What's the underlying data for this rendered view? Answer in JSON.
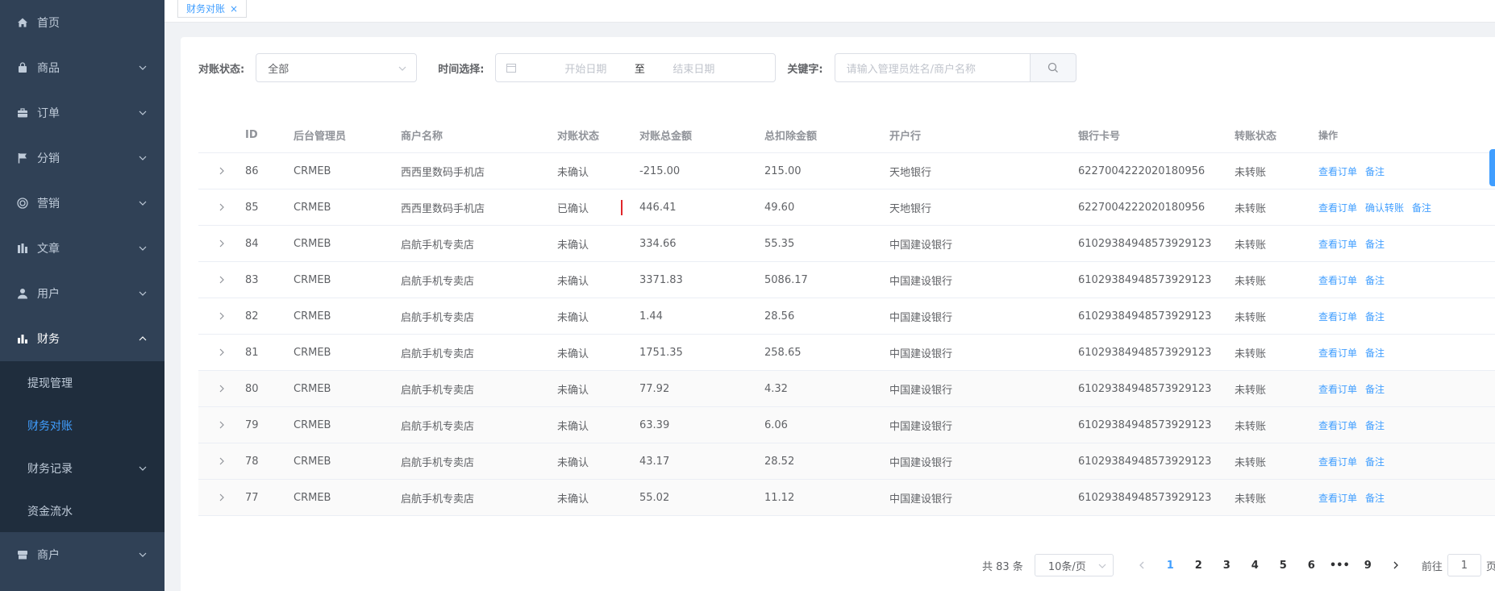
{
  "sidebar": {
    "items": [
      {
        "label": "首页",
        "icon": "home-icon",
        "chevron": false
      },
      {
        "label": "商品",
        "icon": "bag-icon",
        "chevron": true
      },
      {
        "label": "订单",
        "icon": "briefcase-icon",
        "chevron": true
      },
      {
        "label": "分销",
        "icon": "flag-icon",
        "chevron": true
      },
      {
        "label": "营销",
        "icon": "target-icon",
        "chevron": true
      },
      {
        "label": "文章",
        "icon": "chart-bars-icon",
        "chevron": true
      },
      {
        "label": "用户",
        "icon": "user-icon",
        "chevron": true
      },
      {
        "label": "财务",
        "icon": "bar-chart-icon",
        "chevron": true,
        "open": true
      }
    ],
    "finance_sub": [
      {
        "label": "提现管理"
      },
      {
        "label": "财务对账",
        "active": true
      },
      {
        "label": "财务记录",
        "chevron": true
      },
      {
        "label": "资金流水"
      }
    ],
    "after": [
      {
        "label": "商户",
        "icon": "shop-icon",
        "chevron": true
      }
    ]
  },
  "tab": {
    "label": "财务对账",
    "close": "×"
  },
  "filters": {
    "status_label": "对账状态:",
    "status_value": "全部",
    "time_label": "时间选择:",
    "start_placeholder": "开始日期",
    "separator": "至",
    "end_placeholder": "结束日期",
    "keyword_label": "关键字:",
    "keyword_placeholder": "请输入管理员姓名/商户名称"
  },
  "table": {
    "headers": [
      "ID",
      "后台管理员",
      "商户名称",
      "对账状态",
      "对账总金额",
      "总扣除金额",
      "开户行",
      "银行卡号",
      "转账状态",
      "操作"
    ],
    "rows": [
      {
        "id": "86",
        "admin": "CRMEB",
        "shop": "西西里数码手机店",
        "status": "未确认",
        "total": "-215.00",
        "deduct": "215.00",
        "bank": "天地银行",
        "card": "6227004222020180956",
        "transfer": "未转账",
        "ops": [
          "查看订单",
          "备注"
        ]
      },
      {
        "id": "85",
        "admin": "CRMEB",
        "shop": "西西里数码手机店",
        "status": "已确认",
        "total": "446.41",
        "deduct": "49.60",
        "bank": "天地银行",
        "card": "6227004222020180956",
        "transfer": "未转账",
        "ops": [
          "查看订单",
          "确认转账",
          "备注"
        ]
      },
      {
        "id": "84",
        "admin": "CRMEB",
        "shop": "启航手机专卖店",
        "status": "未确认",
        "total": "334.66",
        "deduct": "55.35",
        "bank": "中国建设银行",
        "card": "6102938494857392912​3",
        "transfer": "未转账",
        "ops": [
          "查看订单",
          "备注"
        ]
      },
      {
        "id": "83",
        "admin": "CRMEB",
        "shop": "启航手机专卖店",
        "status": "未确认",
        "total": "3371.83",
        "deduct": "5086.17",
        "bank": "中国建设银行",
        "card": "61029384948573929123",
        "transfer": "未转账",
        "ops": [
          "查看订单",
          "备注"
        ]
      },
      {
        "id": "82",
        "admin": "CRMEB",
        "shop": "启航手机专卖店",
        "status": "未确认",
        "total": "1.44",
        "deduct": "28.56",
        "bank": "中国建设银行",
        "card": "61029384948573929123",
        "transfer": "未转账",
        "ops": [
          "查看订单",
          "备注"
        ]
      },
      {
        "id": "81",
        "admin": "CRMEB",
        "shop": "启航手机专卖店",
        "status": "未确认",
        "total": "1751.35",
        "deduct": "258.65",
        "bank": "中国建设银行",
        "card": "61029384948573929123",
        "transfer": "未转账",
        "ops": [
          "查看订单",
          "备注"
        ]
      },
      {
        "id": "80",
        "admin": "CRMEB",
        "shop": "启航手机专卖店",
        "status": "未确认",
        "total": "77.92",
        "deduct": "4.32",
        "bank": "中国建设银行",
        "card": "61029384948573929123",
        "transfer": "未转账",
        "ops": [
          "查看订单",
          "备注"
        ]
      },
      {
        "id": "79",
        "admin": "CRMEB",
        "shop": "启航手机专卖店",
        "status": "未确认",
        "total": "63.39",
        "deduct": "6.06",
        "bank": "中国建设银行",
        "card": "61029384948573929123",
        "transfer": "未转账",
        "ops": [
          "查看订单",
          "备注"
        ]
      },
      {
        "id": "78",
        "admin": "CRMEB",
        "shop": "启航手机专卖店",
        "status": "未确认",
        "total": "43.17",
        "deduct": "28.52",
        "bank": "中国建设银行",
        "card": "61029384948573929123",
        "transfer": "未转账",
        "ops": [
          "查看订单",
          "备注"
        ]
      },
      {
        "id": "77",
        "admin": "CRMEB",
        "shop": "启航手机专卖店",
        "status": "未确认",
        "total": "55.02",
        "deduct": "11.12",
        "bank": "中国建设银行",
        "card": "61029384948573929123",
        "transfer": "未转账",
        "ops": [
          "查看订单",
          "备注"
        ]
      }
    ]
  },
  "pagination": {
    "total": "共 83 条",
    "page_size": "10条/页",
    "pages": [
      "1",
      "2",
      "3",
      "4",
      "5",
      "6",
      "•••",
      "9"
    ],
    "current": "1",
    "goto_label": "前往",
    "goto_value": "1",
    "goto_suffix": "页"
  },
  "colors": {
    "accent": "#409eff",
    "sidebar_bg": "#304156",
    "highlight": "#e0262a"
  }
}
